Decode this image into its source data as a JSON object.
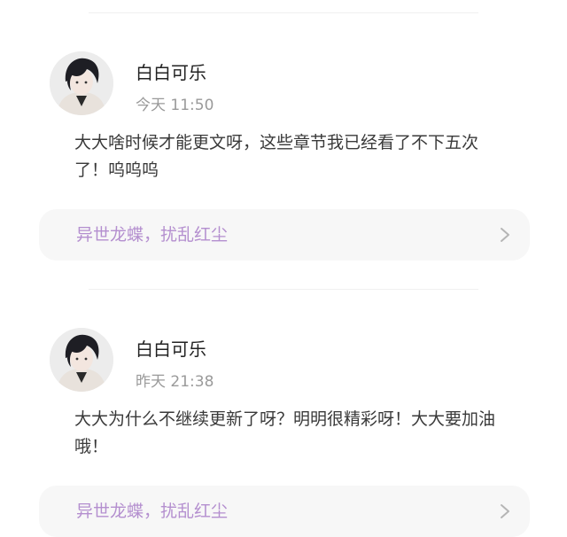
{
  "comments": [
    {
      "username": "白白可乐",
      "timestamp": "今天 11:50",
      "body": "大大啥时候才能更文呀，这些章节我已经看了不下五次了！呜呜呜",
      "book_title": "异世龙蝶，扰乱红尘"
    },
    {
      "username": "白白可乐",
      "timestamp": "昨天 21:38",
      "body": "大大为什么不继续更新了呀？明明很精彩呀！大大要加油哦！",
      "book_title": "异世龙蝶，扰乱红尘"
    }
  ],
  "colors": {
    "book_title": "#b48fcf",
    "card_background": "#f7f7f7",
    "timestamp": "#9a9a9a"
  },
  "icons": {
    "chevron": "chevron-right-icon",
    "avatar": "avatar"
  }
}
